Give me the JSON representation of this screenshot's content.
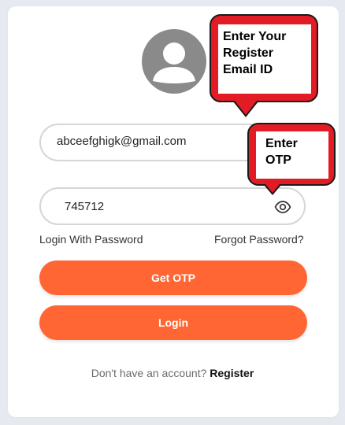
{
  "avatar": {
    "icon": "user-icon"
  },
  "email_field": {
    "value": "abceefghigk@gmail.com",
    "placeholder": ""
  },
  "otp_field": {
    "value": "745712",
    "placeholder": "",
    "toggle_icon": "eye-icon"
  },
  "links": {
    "login_with_password": "Login With Password",
    "forgot_password": "Forgot Password?"
  },
  "buttons": {
    "get_otp": "Get OTP",
    "login": "Login"
  },
  "signup": {
    "prompt": "Don't have an account?",
    "register": "Register"
  },
  "annotations": {
    "email_line1": "Enter Your",
    "email_line2": "Register",
    "email_line3": "Email ID",
    "otp_line1": "Enter",
    "otp_line2": "OTP"
  },
  "colors": {
    "accent": "#ff6633",
    "callout": "#e21b24",
    "avatar": "#8a8a8a",
    "background": "#e6e9ef"
  }
}
